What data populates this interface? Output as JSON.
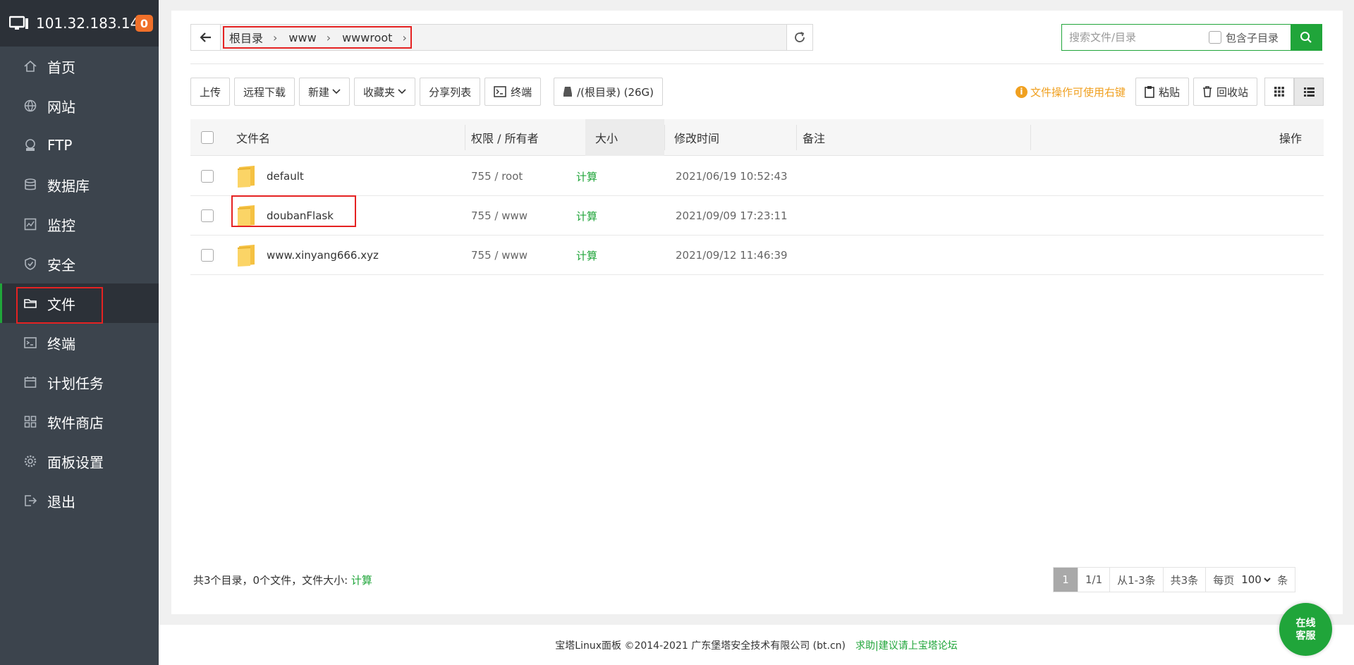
{
  "sidebar": {
    "ip": "101.32.183.14",
    "badge": "0",
    "items": [
      {
        "label": "首页",
        "icon": "home-icon"
      },
      {
        "label": "网站",
        "icon": "globe-icon"
      },
      {
        "label": "FTP",
        "icon": "ftp-icon"
      },
      {
        "label": "数据库",
        "icon": "database-icon"
      },
      {
        "label": "监控",
        "icon": "monitor-chart-icon"
      },
      {
        "label": "安全",
        "icon": "shield-icon"
      },
      {
        "label": "文件",
        "icon": "folder-icon",
        "active": true
      },
      {
        "label": "终端",
        "icon": "terminal-icon"
      },
      {
        "label": "计划任务",
        "icon": "calendar-icon"
      },
      {
        "label": "软件商店",
        "icon": "apps-icon"
      },
      {
        "label": "面板设置",
        "icon": "gear-icon"
      },
      {
        "label": "退出",
        "icon": "logout-icon"
      }
    ]
  },
  "breadcrumb": [
    "根目录",
    "www",
    "wwwroot"
  ],
  "search": {
    "placeholder": "搜索文件/目录",
    "subdir_label": "包含子目录"
  },
  "toolbar": {
    "upload": "上传",
    "remote_download": "远程下载",
    "new": "新建",
    "favorites": "收藏夹",
    "share_list": "分享列表",
    "terminal": "终端",
    "disk": "/(根目录) (26G)",
    "tip": "文件操作可使用右键",
    "paste": "粘贴",
    "recycle": "回收站"
  },
  "table": {
    "headers": {
      "name": "文件名",
      "perm": "权限 / 所有者",
      "size": "大小",
      "mtime": "修改时间",
      "remark": "备注",
      "ops": "操作"
    },
    "rows": [
      {
        "name": "default",
        "perm": "755 / root",
        "size": "计算",
        "mtime": "2021/06/19 10:52:43"
      },
      {
        "name": "doubanFlask",
        "perm": "755 / www",
        "size": "计算",
        "mtime": "2021/09/09 17:23:11"
      },
      {
        "name": "www.xinyang666.xyz",
        "perm": "755 / www",
        "size": "计算",
        "mtime": "2021/09/12 11:46:39"
      }
    ]
  },
  "summary": {
    "text": "共3个目录，0个文件，文件大小: ",
    "calc": "计算"
  },
  "pager": {
    "current": "1",
    "pages": "1/1",
    "range": "从1-3条",
    "total": "共3条",
    "per_page_label": "每页",
    "per_page": "100",
    "unit": "条"
  },
  "footer": {
    "copyright": "宝塔Linux面板 ©2014-2021 广东堡塔安全技术有限公司 (bt.cn)",
    "help": "求助|建议请上宝塔论坛"
  },
  "chat": {
    "line1": "在线",
    "line2": "客服"
  },
  "colors": {
    "accent": "#20a53a",
    "sidebar_bg": "#3c444d",
    "highlight": "#e52222",
    "badge": "#f0702a"
  }
}
